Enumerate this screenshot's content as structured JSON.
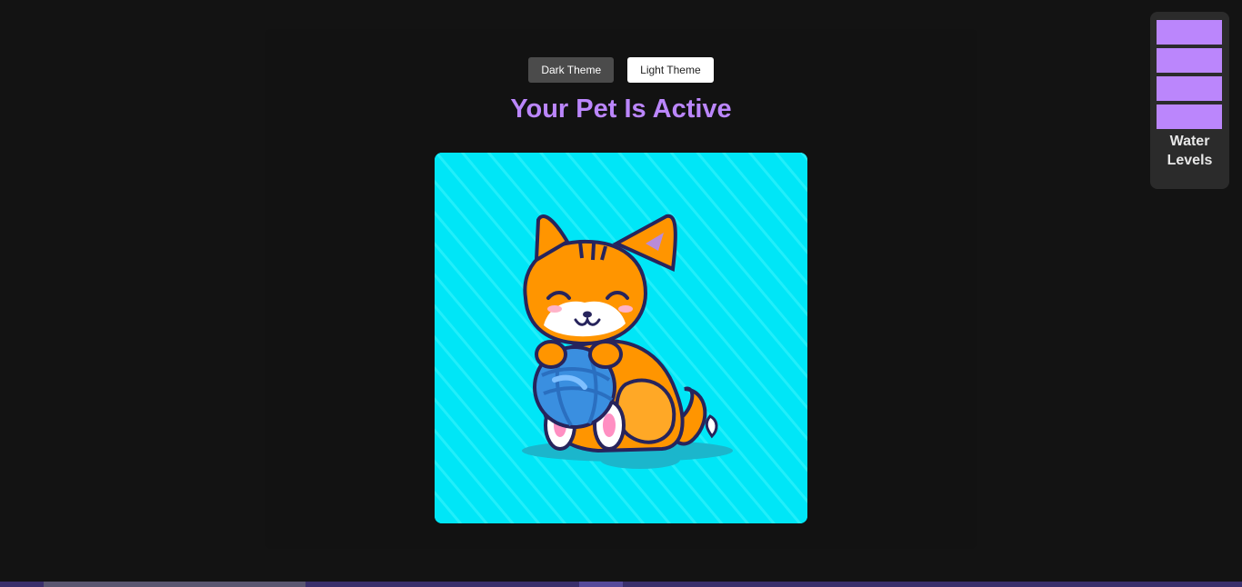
{
  "theme_toggle": {
    "dark_label": "Dark Theme",
    "light_label": "Light Theme"
  },
  "status": {
    "title": "Your Pet Is Active"
  },
  "pet": {
    "image_description": "cartoon orange cat playing with a blue yarn ball",
    "background_color": "#00e6f7"
  },
  "water_levels": {
    "label_line1": "Water",
    "label_line2": "Levels",
    "filled_bars": 4,
    "bar_color": "#bb86fc"
  },
  "colors": {
    "accent": "#bb86fc",
    "background": "#131313",
    "panel": "#2b2b2b"
  }
}
